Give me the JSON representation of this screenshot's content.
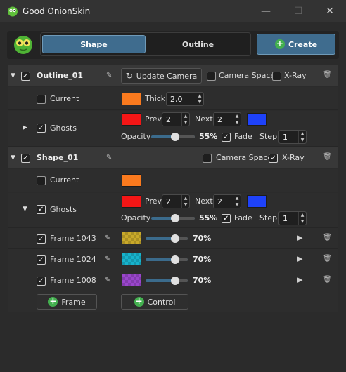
{
  "window": {
    "title": "Good OnionSkin",
    "minimize": "—",
    "maximize": "☐",
    "close": "✕"
  },
  "tabs": {
    "shape": "Shape",
    "outline": "Outline"
  },
  "create_label": "Create",
  "outline_layer": {
    "name": "Outline_01",
    "update_camera": "Update Camera",
    "camera_space": "Camera Space",
    "xray": "X-Ray",
    "current_label": "Current",
    "thick_label": "Thick",
    "thick_value": "2,0",
    "current_color": "#fa7a1e",
    "ghosts_label": "Ghosts",
    "prev_label": "Prev",
    "prev_value": "2",
    "next_label": "Next",
    "next_value": "2",
    "prev_color": "#f41616",
    "next_color": "#1e42fa",
    "opacity_label": "Opacity",
    "opacity_value": "55%",
    "opacity_fraction": 0.55,
    "fade_label": "Fade",
    "step_label": "Step",
    "step_value": "1"
  },
  "shape_layer": {
    "name": "Shape_01",
    "camera_space": "Camera Space",
    "xray": "X-Ray",
    "current_label": "Current",
    "current_color": "#fa7a1e",
    "ghosts_label": "Ghosts",
    "prev_label": "Prev",
    "prev_value": "2",
    "next_label": "Next",
    "next_value": "2",
    "prev_color": "#f41616",
    "next_color": "#1e42fa",
    "opacity_label": "Opacity",
    "opacity_value": "55%",
    "opacity_fraction": 0.55,
    "fade_label": "Fade",
    "step_label": "Step",
    "step_value": "1",
    "frames": [
      {
        "label": "Frame 1043",
        "color": "#c9a92a",
        "opacity": "70%",
        "fraction": 0.7
      },
      {
        "label": "Frame 1024",
        "color": "#17b3cc",
        "opacity": "70%",
        "fraction": 0.7
      },
      {
        "label": "Frame 1008",
        "color": "#9a46cc",
        "opacity": "70%",
        "fraction": 0.7
      }
    ]
  },
  "add_frame": "Frame",
  "add_control": "Control"
}
